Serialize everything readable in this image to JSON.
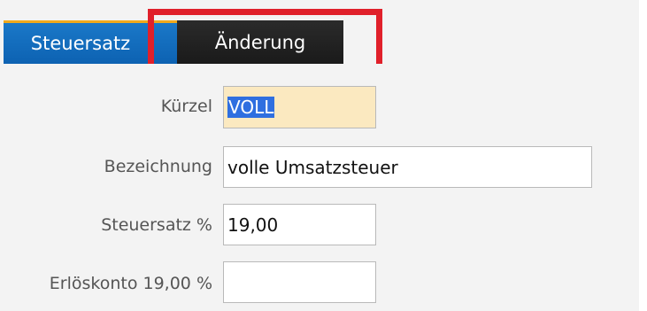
{
  "tabs": {
    "steuersatz_label": "Steuersatz",
    "aenderung_label": "Änderung"
  },
  "form": {
    "kuerzel_label": "Kürzel",
    "kuerzel_value": "VOLL",
    "bezeichnung_label": "Bezeichnung",
    "bezeichnung_value": "volle Umsatzsteuer",
    "steuersatz_label": "Steuersatz %",
    "steuersatz_value": "19,00",
    "erloeskonto_label": "Erlöskonto 19,00 %",
    "erloeskonto_value": ""
  },
  "colors": {
    "active_tab": "#0d62b2",
    "dark_tab": "#1a1a1a",
    "highlight": "#e0202a",
    "kuerzel_bg": "#fbe9c0"
  }
}
